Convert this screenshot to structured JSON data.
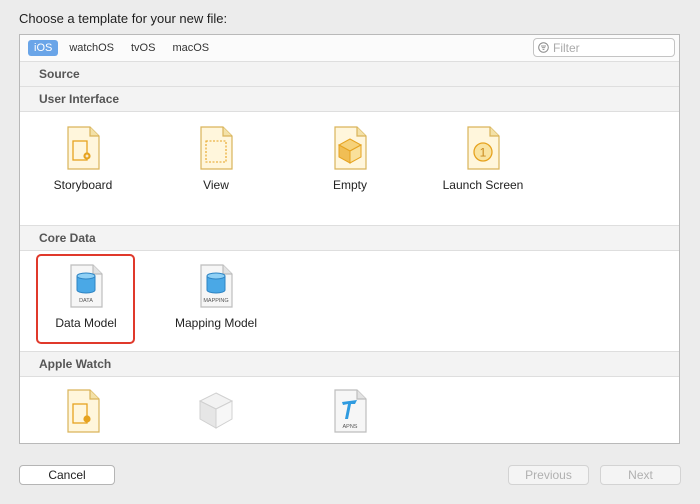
{
  "prompt": "Choose a template for your new file:",
  "platforms": [
    "iOS",
    "watchOS",
    "tvOS",
    "macOS"
  ],
  "filter": {
    "placeholder": "Filter",
    "value": ""
  },
  "sections": {
    "source": "Source",
    "user_interface": {
      "title": "User Interface",
      "items": [
        "Storyboard",
        "View",
        "Empty",
        "Launch Screen"
      ]
    },
    "core_data": {
      "title": "Core Data",
      "items": [
        "Data Model",
        "Mapping Model"
      ],
      "data_badge": "DATA",
      "mapping_badge": "MAPPING"
    },
    "apple_watch": {
      "title": "Apple Watch",
      "apns_badge": "APNS"
    }
  },
  "launch_badge": "1",
  "buttons": {
    "cancel": "Cancel",
    "previous": "Previous",
    "next": "Next"
  },
  "colors": {
    "selected_tab": "#6aa5e8",
    "selection_outline": "#e0392b"
  }
}
